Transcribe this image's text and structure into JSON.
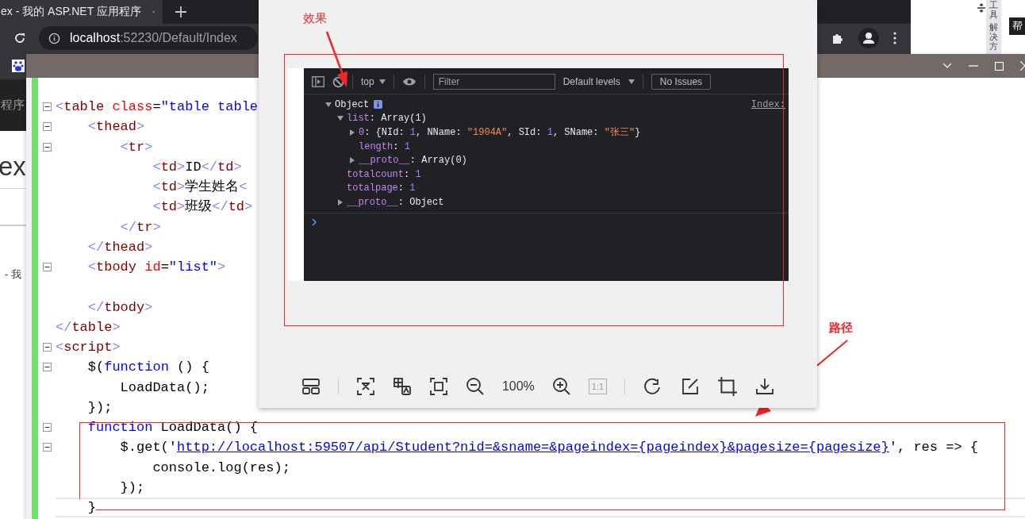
{
  "browser": {
    "tab_title": "ex - 我的 ASP.NET 应用程序",
    "address": {
      "host": "localhost",
      "path": ":52230/Default/Index"
    }
  },
  "page_behind": {
    "nav_text": "程序",
    "heading": "ex",
    "footer_text": "- 我"
  },
  "ide_side": {
    "tabs": [
      "工具",
      "解决方"
    ],
    "label": "帮"
  },
  "editor": {
    "lines": [
      {
        "fold": true,
        "tokens": [
          {
            "kind": "bracket",
            "text": "<"
          },
          {
            "kind": "tag",
            "text": "table"
          },
          {
            "kind": "attr",
            "text": " class"
          },
          {
            "kind": "plain",
            "text": "="
          },
          {
            "kind": "value",
            "text": "\"table table"
          }
        ]
      },
      {
        "fold": true,
        "tokens": [
          {
            "kind": "bracket",
            "text": "    <"
          },
          {
            "kind": "tag",
            "text": "thead"
          },
          {
            "kind": "bracket",
            "text": ">"
          }
        ]
      },
      {
        "fold": true,
        "tokens": [
          {
            "kind": "bracket",
            "text": "        <"
          },
          {
            "kind": "tag",
            "text": "tr"
          },
          {
            "kind": "bracket",
            "text": ">"
          }
        ]
      },
      {
        "fold": false,
        "tokens": [
          {
            "kind": "bracket",
            "text": "            <"
          },
          {
            "kind": "tag",
            "text": "td"
          },
          {
            "kind": "bracket",
            "text": ">"
          },
          {
            "kind": "plain",
            "text": "ID"
          },
          {
            "kind": "bracket",
            "text": "</"
          },
          {
            "kind": "tag",
            "text": "td"
          },
          {
            "kind": "bracket",
            "text": ">"
          }
        ]
      },
      {
        "fold": false,
        "tokens": [
          {
            "kind": "bracket",
            "text": "            <"
          },
          {
            "kind": "tag",
            "text": "td"
          },
          {
            "kind": "bracket",
            "text": ">"
          },
          {
            "kind": "plain",
            "text": "学生姓名"
          },
          {
            "kind": "bracket",
            "text": "<"
          }
        ]
      },
      {
        "fold": false,
        "tokens": [
          {
            "kind": "bracket",
            "text": "            <"
          },
          {
            "kind": "tag",
            "text": "td"
          },
          {
            "kind": "bracket",
            "text": ">"
          },
          {
            "kind": "plain",
            "text": "班级"
          },
          {
            "kind": "bracket",
            "text": "</"
          },
          {
            "kind": "tag",
            "text": "td"
          },
          {
            "kind": "bracket",
            "text": ">"
          }
        ]
      },
      {
        "fold": false,
        "tokens": [
          {
            "kind": "bracket",
            "text": "        </"
          },
          {
            "kind": "tag",
            "text": "tr"
          },
          {
            "kind": "bracket",
            "text": ">"
          }
        ]
      },
      {
        "fold": false,
        "tokens": [
          {
            "kind": "bracket",
            "text": "    </"
          },
          {
            "kind": "tag",
            "text": "thead"
          },
          {
            "kind": "bracket",
            "text": ">"
          }
        ]
      },
      {
        "fold": true,
        "tokens": [
          {
            "kind": "bracket",
            "text": "    <"
          },
          {
            "kind": "tag",
            "text": "tbody"
          },
          {
            "kind": "attr",
            "text": " id"
          },
          {
            "kind": "plain",
            "text": "="
          },
          {
            "kind": "value",
            "text": "\"list\""
          },
          {
            "kind": "bracket",
            "text": ">"
          }
        ]
      },
      {
        "fold": false
      },
      {
        "fold": false,
        "tokens": [
          {
            "kind": "bracket",
            "text": "    </"
          },
          {
            "kind": "tag",
            "text": "tbody"
          },
          {
            "kind": "bracket",
            "text": ">"
          }
        ]
      },
      {
        "fold": false,
        "tokens": [
          {
            "kind": "bracket",
            "text": "</"
          },
          {
            "kind": "tag",
            "text": "table"
          },
          {
            "kind": "bracket",
            "text": ">"
          }
        ]
      },
      {
        "fold": true,
        "tokens": [
          {
            "kind": "bracket",
            "text": "<"
          },
          {
            "kind": "tag",
            "text": "script"
          },
          {
            "kind": "bracket",
            "text": ">"
          }
        ]
      },
      {
        "fold": true,
        "tokens": [
          {
            "kind": "plain",
            "text": "    $("
          },
          {
            "kind": "keyword",
            "text": "function"
          },
          {
            "kind": "plain",
            "text": " () {"
          }
        ]
      },
      {
        "fold": false,
        "tokens": [
          {
            "kind": "plain",
            "text": "        LoadData();"
          }
        ]
      },
      {
        "fold": false,
        "tokens": [
          {
            "kind": "plain",
            "text": "    });"
          }
        ]
      },
      {
        "fold": true,
        "tokens": [
          {
            "kind": "keyword",
            "text": "    function"
          },
          {
            "kind": "plain",
            "text": " LoadData() {"
          }
        ]
      },
      {
        "fold": true,
        "tokens": [
          {
            "kind": "plain",
            "text": "        $.get('"
          },
          {
            "kind": "link",
            "text": "http://localhost:59507/api/Student?nid=&sname=&pageindex={pageindex}&pagesize={pagesize}"
          },
          {
            "kind": "plain",
            "text": "', res => {"
          }
        ]
      },
      {
        "fold": false,
        "tokens": [
          {
            "kind": "plain",
            "text": "            console.log(res);"
          }
        ]
      },
      {
        "fold": false,
        "tokens": [
          {
            "kind": "plain",
            "text": "        });"
          }
        ]
      },
      {
        "fold": false,
        "current": true,
        "tokens": [
          {
            "kind": "plain",
            "text": "    }"
          }
        ]
      }
    ]
  },
  "annotations": {
    "effect": "效果",
    "path": "路径"
  },
  "image_viewer": {
    "devtools": {
      "context": "top",
      "filter_placeholder": "Filter",
      "levels": "Default levels",
      "issues": "No Issues",
      "source_link": "Index:",
      "tree": {
        "label": "Object",
        "expanded": true,
        "children": [
          {
            "key": "list",
            "kind": "group",
            "expanded": true,
            "value": [
              {
                "kind": "plain",
                "text": ": Array(1)"
              }
            ],
            "children": [
              {
                "key": "0",
                "kind": "group",
                "expanded": false,
                "value": [
                  {
                    "kind": "plain",
                    "text": ": {NId: "
                  },
                  {
                    "kind": "number",
                    "text": "1"
                  },
                  {
                    "kind": "plain",
                    "text": ", NName: "
                  },
                  {
                    "kind": "string",
                    "text": "\"1904A\""
                  },
                  {
                    "kind": "plain",
                    "text": ", SId: "
                  },
                  {
                    "kind": "number",
                    "text": "1"
                  },
                  {
                    "kind": "plain",
                    "text": ", SName: "
                  },
                  {
                    "kind": "string",
                    "text": "\"张三\""
                  },
                  {
                    "kind": "plain",
                    "text": "}"
                  }
                ]
              },
              {
                "key": "length",
                "kind": "leaf",
                "value": [
                  {
                    "kind": "plain",
                    "text": ": "
                  },
                  {
                    "kind": "number",
                    "text": "1"
                  }
                ]
              },
              {
                "key": "__proto__",
                "kind": "group",
                "expanded": false,
                "value": [
                  {
                    "kind": "plain",
                    "text": ": Array(0)"
                  }
                ]
              }
            ]
          },
          {
            "key": "totalcount",
            "kind": "leaf",
            "value": [
              {
                "kind": "plain",
                "text": ": "
              },
              {
                "kind": "number",
                "text": "1"
              }
            ]
          },
          {
            "key": "totalpage",
            "kind": "leaf",
            "value": [
              {
                "kind": "plain",
                "text": ": "
              },
              {
                "kind": "number",
                "text": "1"
              }
            ]
          },
          {
            "key": "__proto__",
            "kind": "group",
            "expanded": false,
            "value": [
              {
                "kind": "plain",
                "text": ": Object"
              }
            ]
          }
        ]
      }
    },
    "toolbar": {
      "zoom": "100%",
      "actual_size": {
        "label": "1:1",
        "disabled": true
      }
    }
  }
}
